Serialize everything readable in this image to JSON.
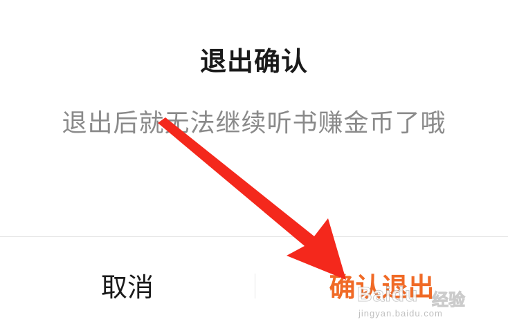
{
  "dialog": {
    "title": "退出确认",
    "message": "退出后就无法继续听书赚金币了哦",
    "cancel_label": "取消",
    "confirm_label": "确认退出"
  },
  "colors": {
    "confirm": "#f06a26",
    "arrow": "#f4281c",
    "message": "#8a8a8a"
  },
  "watermark": {
    "brand": "Baidu",
    "brand_cn": "经验",
    "url": "jingyan.baidu.com"
  }
}
